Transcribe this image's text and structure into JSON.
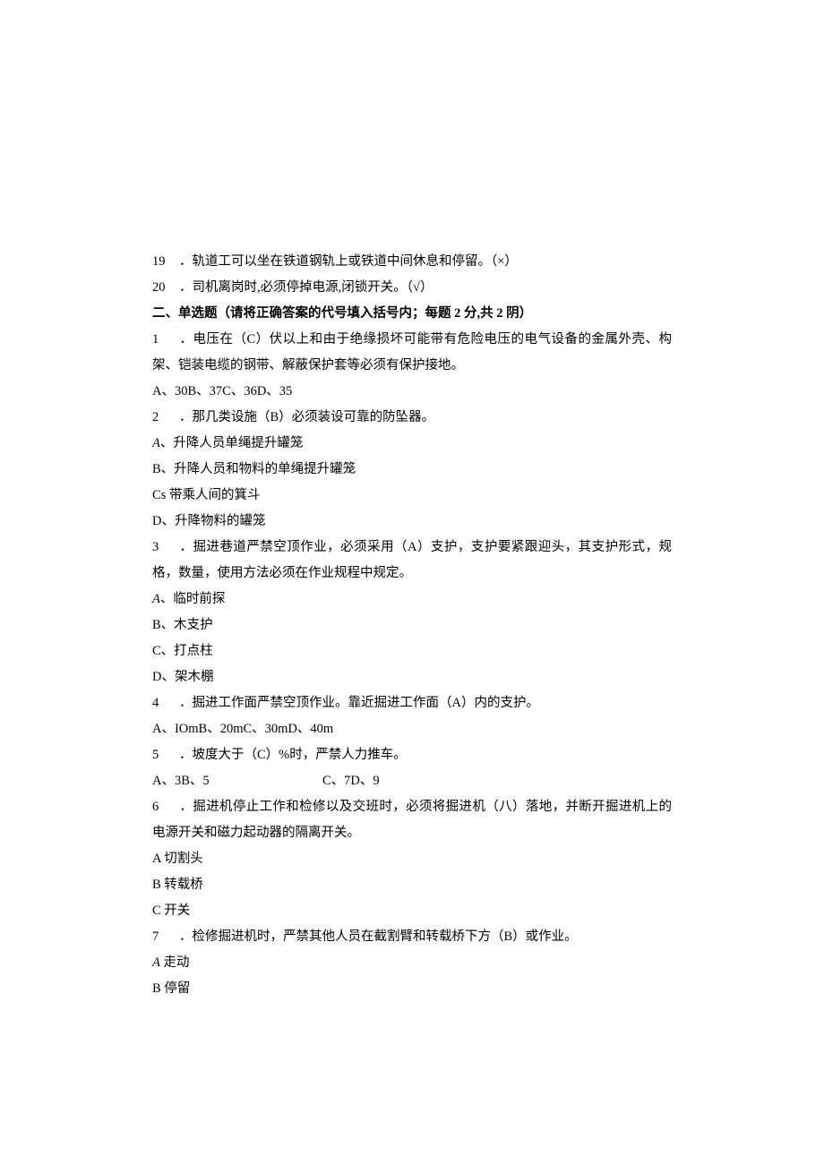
{
  "tf": {
    "q19": {
      "num": "19",
      "text": "．轨道工可以坐在铁道钢轨上或铁道中间休息和停留。（×）"
    },
    "q20": {
      "num": "20",
      "text": "．司机离岗时,必须停掉电源,闭锁开关。（√）"
    }
  },
  "section2_title": "二、单选题（请将正确答案的代号填入括号内；每题 2 分,共 2 阴）",
  "mc": {
    "q1": {
      "num": "1",
      "text": "．电压在（C）伏以上和由于绝缘损坏可能带有危险电压的电气设备的金属外壳、构架、铠装电缆的钢带、解蔽保护套等必须有保护接地。",
      "opts": "A、30B、37C、36D、35"
    },
    "q2": {
      "num": "2",
      "text": "．那几类设施（B）必须装设可靠的防坠器。",
      "a_label": "A",
      "a": "、升降人员单绳提升罐笼",
      "b": "B、升降人员和物料的单绳提升罐笼",
      "c": "Cs 带乘人间的箕斗",
      "d": "D、升降物料的罐笼"
    },
    "q3": {
      "num": "3",
      "text": "．掘进巷道严禁空顶作业，必须采用（A）支护，支护要紧跟迎头，其支护形式，规格，数量，使用方法必须在作业规程中规定。",
      "a_label": "A",
      "a": "、临时前探",
      "b": "B、木支护",
      "c": "C、打点柱",
      "d": "D、架木棚"
    },
    "q4": {
      "num": "4",
      "text": "．掘进工作面严禁空顶作业。靠近掘进工作面（A）内的支护。",
      "opts": "A、IOmB、20mC、30mD、40m"
    },
    "q5": {
      "num": "5",
      "text": "．坡度大于（C）%时，严禁人力推车。",
      "opts_left": "A、3B、5",
      "opts_right": "C、7D、9"
    },
    "q6": {
      "num": "6",
      "text": "．掘进机停止工作和检修以及交班时，必须将掘进机（八）落地，并断开掘进机上的电源开关和磁力起动器的隔离开关。",
      "a": "A 切割头",
      "b": "B 转载桥",
      "c": "C 开关"
    },
    "q7": {
      "num": "7",
      "text": "．检修掘进机时，严禁其他人员在截割臂和转载桥下方（B）或作业。",
      "a_label": "A",
      "a": " 走动",
      "b": "B 停留"
    }
  }
}
